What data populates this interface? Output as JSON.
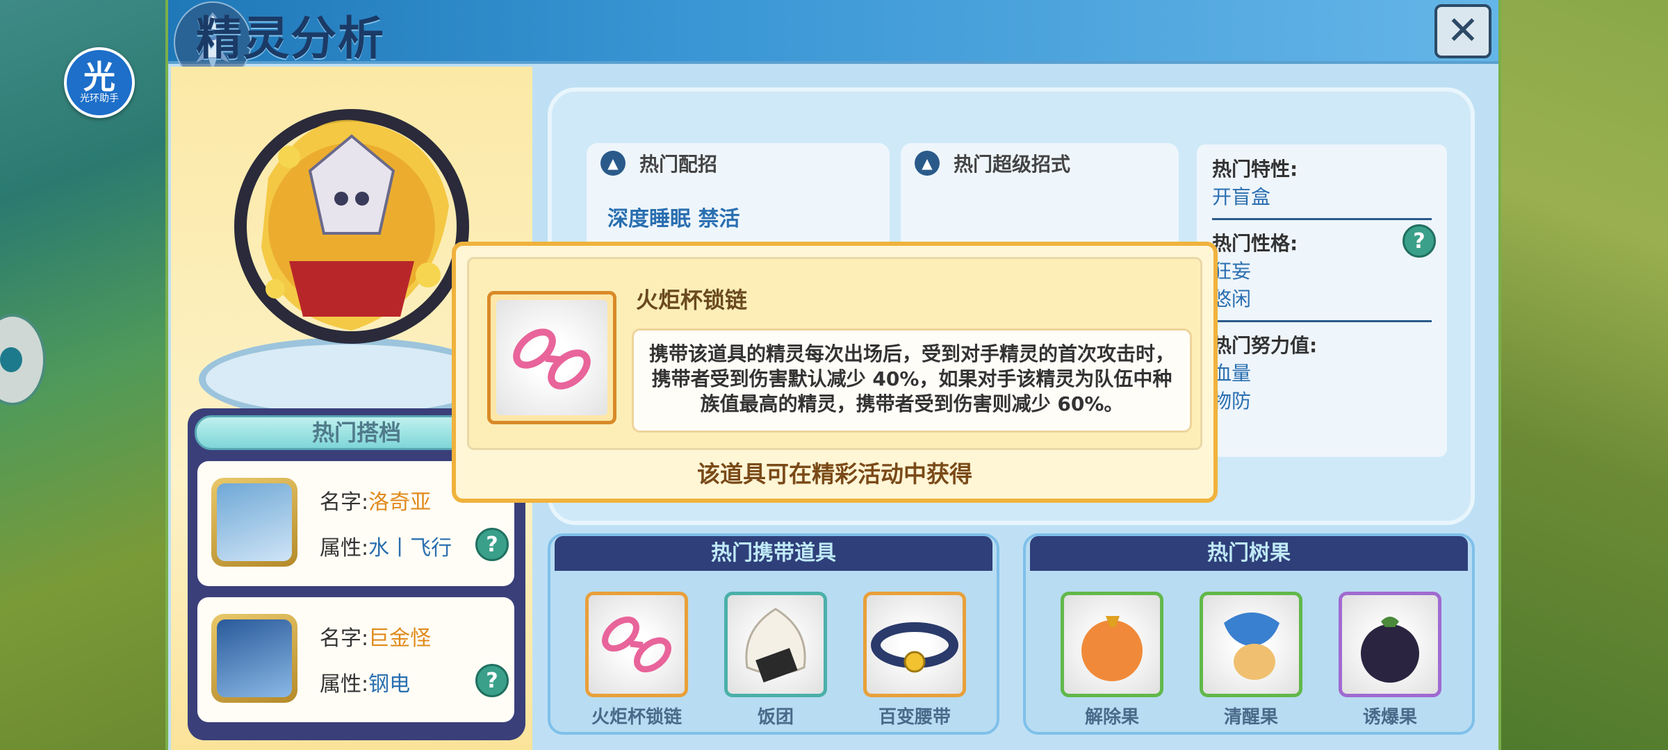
{
  "app": {
    "assist_badge_char": "光",
    "assist_badge_label": "光环助手"
  },
  "header": {
    "title": "精灵分析",
    "close_glyph": "✕"
  },
  "partners": {
    "title": "热门搭档",
    "name_label": "名字:",
    "attr_label": "属性:",
    "help_glyph": "?",
    "items": [
      {
        "name": "洛奇亚",
        "attr": "水丨飞行"
      },
      {
        "name": "巨金怪",
        "attr": "钢电"
      }
    ]
  },
  "tabs": {
    "moves": {
      "title": "热门配招",
      "partial_text": "深度睡眠  禁活"
    },
    "super_moves": {
      "title": "热门超级招式"
    }
  },
  "info": {
    "trait_label": "热门特性:",
    "trait_value": "开盲盒",
    "nature_label": "热门性格:",
    "nature_values": [
      "狂妄",
      "悠闲"
    ],
    "ev_label": "热门努力值:",
    "ev_values": [
      "血量",
      "物防"
    ],
    "help_glyph": "?"
  },
  "items_box": {
    "title": "热门携带道具",
    "items": [
      "火炬杯锁链",
      "饭团",
      "百变腰带"
    ]
  },
  "berries_box": {
    "title": "热门树果",
    "items": [
      "解除果",
      "清醒果",
      "诱爆果"
    ]
  },
  "popup": {
    "item_name": "火炬杯锁链",
    "description": "携带该道具的精灵每次出场后，受到对手精灵的首次攻击时，携带者受到伤害默认减少 40%，如果对手该精灵为队伍中种族值最高的精灵，携带者受到伤害则减少 60%。",
    "source": "该道具可在精彩活动中获得"
  },
  "colors": {
    "header_blue": "#1f78b8",
    "popup_border": "#f0b23c",
    "name_orange": "#e08a1c",
    "attr_blue": "#2a6fb0",
    "panel_navy": "#2f3f7a"
  }
}
